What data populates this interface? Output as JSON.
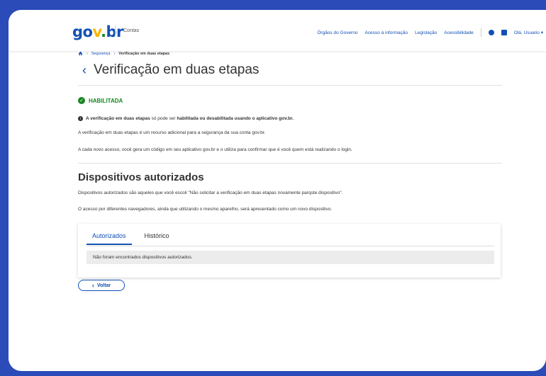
{
  "header": {
    "logo": {
      "g": "go",
      "o": "v",
      "v": ".",
      "br": "br"
    },
    "brand_sub": "Contas",
    "nav": [
      "Órgãos do Governo",
      "Acesso à informação",
      "Legislação",
      "Acessibilidade"
    ],
    "user_greeting": "Olá, Usuario"
  },
  "breadcrumb": {
    "items": [
      "Segurança",
      "Verificação em duas etapas"
    ]
  },
  "page_title": "Verificação em duas etapas",
  "status": "HABILITADA",
  "info": {
    "bold1": "A verificação em duas etapas",
    "normal1": " só pode ser ",
    "bold2": "habilitada ou desabilitada usando o aplicativo gov.br."
  },
  "paragraphs": [
    "A verificação em duas etapas é um recurso adicional para a segurança da sua conta gov.br.",
    "A cada novo acesso, você gera um código em seu aplicativo gov.br e o utiliza para confirmar que é você quem está realizando o login."
  ],
  "devices": {
    "title": "Dispositivos autorizados",
    "p1": "Dispositivos autorizados são aqueles que você escoli \"Não solicitar a verificação em duas etapas novamente parqste dispositivo\".",
    "p2": "O acesso por diferentes navegadores, ainda que utilizando o mesmo aparelho, será apresentado como um novo dispositivo.",
    "tabs": [
      "Autorizados",
      "Histórico"
    ],
    "empty_message": "Não foram encontrados dispositivos autorizados."
  },
  "back_button": "Voltar",
  "colors": {
    "primary": "#1351b4",
    "success": "#168821",
    "frame_bg": "#2a4bb8"
  }
}
